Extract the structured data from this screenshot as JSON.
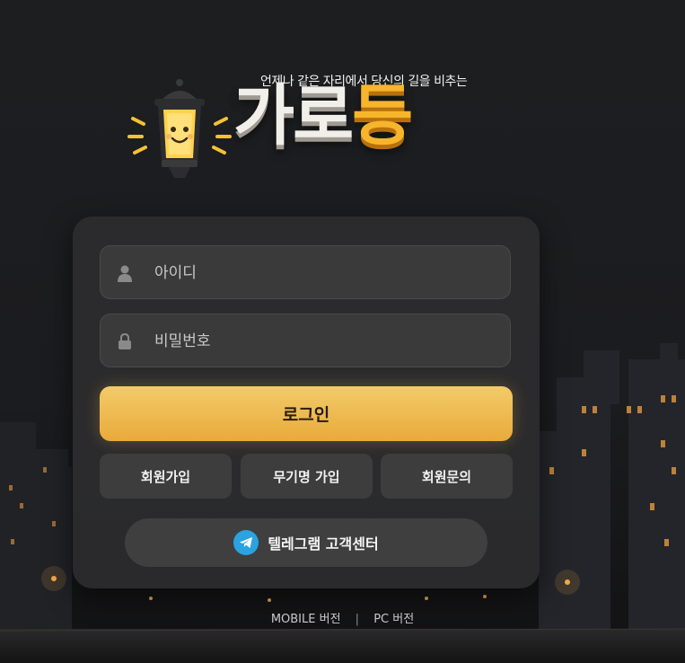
{
  "header": {
    "tagline": "언제나 같은 자리에서 당신의 길을 비추는",
    "brand_part1": "가로",
    "brand_part2": "등"
  },
  "form": {
    "username_placeholder": "아이디",
    "password_placeholder": "비밀번호",
    "login_label": "로그인"
  },
  "actions": {
    "signup_label": "회원가입",
    "no_deposit_signup_label": "무기명 가입",
    "inquiry_label": "회원문의",
    "telegram_label": "텔레그램 고객센터"
  },
  "footer": {
    "mobile_label": "MOBILE 버전",
    "separator": "|",
    "pc_label": "PC 버전"
  },
  "colors": {
    "accent": "#efb64a",
    "card_bg": "#2c2c2e",
    "telegram": "#2aa3e0"
  },
  "icons": {
    "username": "user-icon",
    "password": "lock-icon",
    "telegram": "telegram-icon",
    "logo": "street-lamp-icon"
  }
}
